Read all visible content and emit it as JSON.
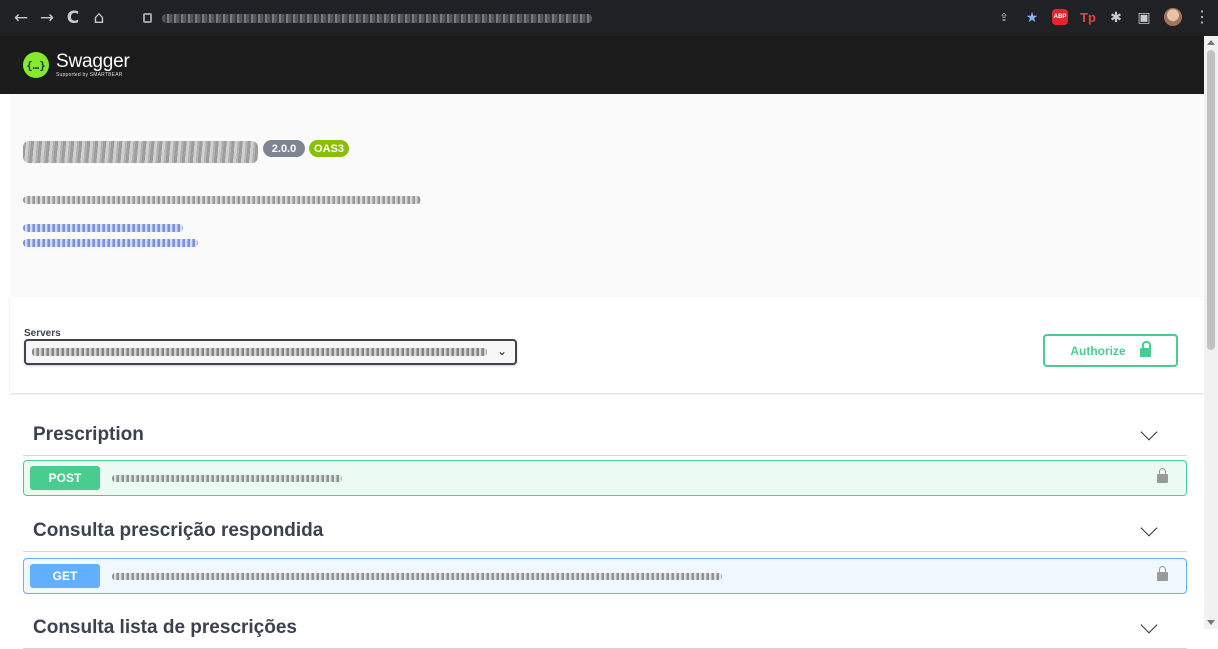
{
  "browser": {
    "nav": {
      "back": "←",
      "forward": "→",
      "reload": "C",
      "home": "⌂"
    },
    "extensions": {
      "share": "⇪",
      "star": "★",
      "abp": "ABP",
      "tp": "Tp",
      "puzzle": "✱",
      "sidepanel": "▣",
      "menu": "⋮"
    }
  },
  "swagger": {
    "logo_glyph": "{…}",
    "name": "Swagger",
    "tagline": "Supported by SMARTBEAR",
    "version_badge": "2.0.0",
    "oas_badge": "OAS3"
  },
  "servers": {
    "label": "Servers",
    "chevron": "⌄"
  },
  "authorize": {
    "label": "Authorize"
  },
  "tags": [
    {
      "name": "Prescription",
      "method": "POST"
    },
    {
      "name": "Consulta prescrição respondida",
      "method": "GET"
    },
    {
      "name": "Consulta lista de prescrições"
    }
  ],
  "colors": {
    "post": "#49cc90",
    "get": "#61affe",
    "topbar": "#1b1b1b",
    "oas": "#89bf04",
    "version": "#7d8492"
  }
}
